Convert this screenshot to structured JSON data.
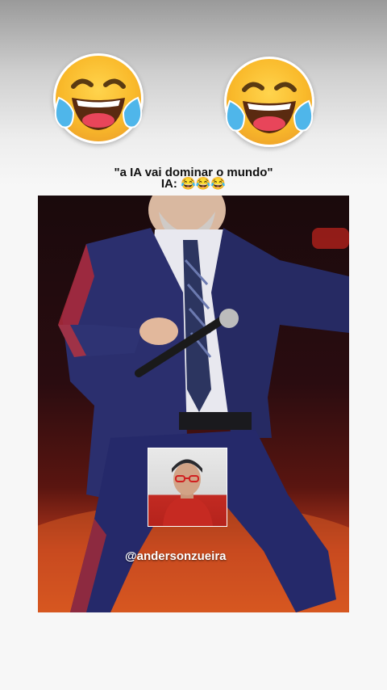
{
  "caption": {
    "line1": "\"a IA vai dominar o mundo\"",
    "line2": "IA: 😂😂😂"
  },
  "stickers": [
    {
      "icon": "face-with-tears-of-joy-icon"
    },
    {
      "icon": "face-with-tears-of-joy-icon"
    }
  ],
  "photo": {
    "description_icon": "dancing-man-photo"
  },
  "overlay": {
    "handle": "@andersonzueira"
  },
  "colors": {
    "emoji_yellow": "#f9b92a",
    "tear_blue": "#4fb6ea",
    "suit_blue": "#2a2f6e",
    "stage_red": "#d9551e"
  }
}
